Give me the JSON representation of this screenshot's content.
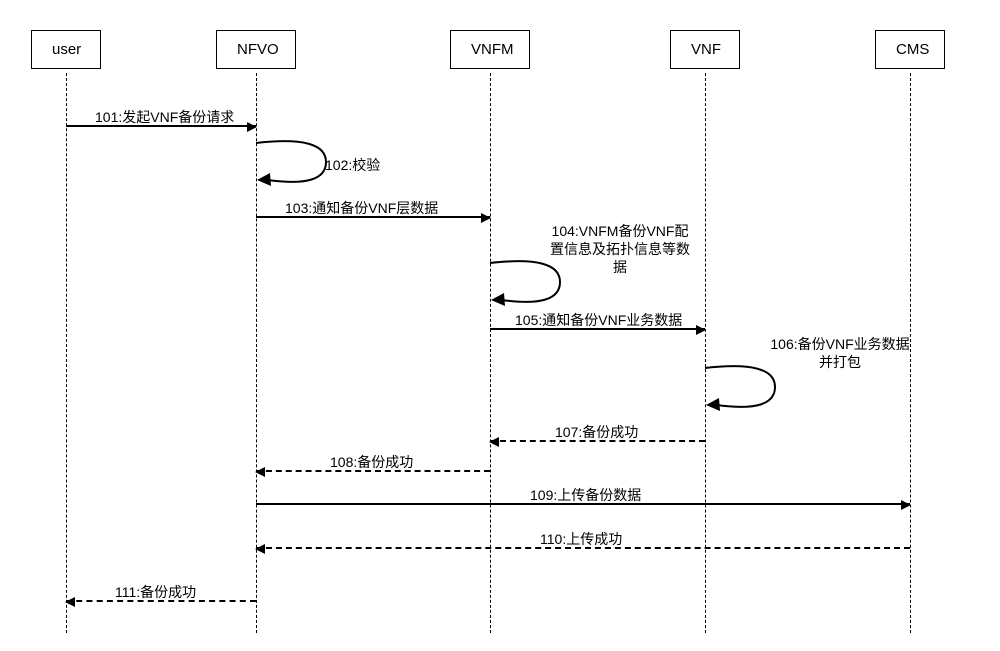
{
  "participants": {
    "user": "user",
    "nfvo": "NFVO",
    "vnfm": "VNFM",
    "vnf": "VNF",
    "cms": "CMS"
  },
  "messages": {
    "m101": "101:发起VNF备份请求",
    "m102": "102:校验",
    "m103": "103:通知备份VNF层数据",
    "m104_l1": "104:VNFM备份VNF配",
    "m104_l2": "置信息及拓扑信息等数",
    "m104_l3": "据",
    "m105": "105:通知备份VNF业务数据",
    "m106_l1": "106:备份VNF业务数据",
    "m106_l2": "并打包",
    "m107": "107:备份成功",
    "m108": "108:备份成功",
    "m109": "109:上传备份数据",
    "m110": "110:上传成功",
    "m111": "111:备份成功"
  }
}
